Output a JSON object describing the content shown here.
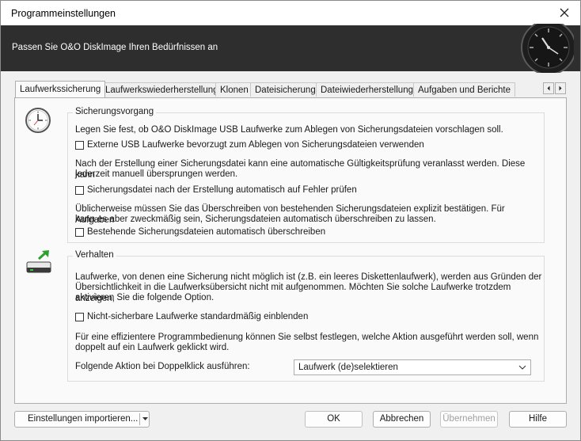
{
  "window": {
    "title": "Programmeinstellungen",
    "banner_text": "Passen Sie O&O DiskImage Ihren Bedürfnissen an"
  },
  "tabs": [
    {
      "label": "Laufwerkssicherung",
      "active": true
    },
    {
      "label": "Laufwerkswiederherstellung",
      "active": false
    },
    {
      "label": "Klonen",
      "active": false
    },
    {
      "label": "Dateisicherung",
      "active": false
    },
    {
      "label": "Dateiwiederherstellung",
      "active": false
    },
    {
      "label": "Aufgaben und Berichte",
      "active": false
    }
  ],
  "group_backup": {
    "title": "Sicherungsvorgang",
    "intro": "Legen Sie fest, ob O&O DiskImage USB Laufwerke zum Ablegen von Sicherungsdateien vorschlagen soll.",
    "chk_usb": "Externe USB Laufwerke bevorzugt zum Ablegen von Sicherungsdateien verwenden",
    "verify_text_1": "Nach der Erstellung einer Sicherungsdatei kann eine automatische Gültigkeitsprüfung veranlasst werden. Diese kann",
    "verify_text_2": "jederzeit manuell übersprungen werden.",
    "chk_verify": "Sicherungsdatei nach der Erstellung automatisch auf Fehler prüfen",
    "overwrite_text_1": "Üblicherweise müssen Sie das Überschreiben von bestehenden Sicherungsdateien explizit bestätigen. Für Aufgaben",
    "overwrite_text_2": "kann es aber zweckmäßig sein, Sicherungsdateien automatisch überschreiben zu lassen.",
    "chk_overwrite": "Bestehende Sicherungsdateien automatisch überschreiben"
  },
  "group_behavior": {
    "title": "Verhalten",
    "drives_text_1": "Laufwerke, von denen eine Sicherung nicht möglich ist (z.B. ein leeres Diskettenlaufwerk), werden aus Gründen der",
    "drives_text_2": "Übersichtlichkeit in die Laufwerksübersicht nicht mit aufgenommen. Möchten Sie solche Laufwerke trotzdem anzeigen,",
    "drives_text_3": "aktivieren Sie die folgende Option.",
    "chk_show": "Nicht-sicherbare Laufwerke standardmäßig einblenden",
    "action_text_1": "Für eine effizientere Programmbedienung können Sie selbst festlegen, welche Aktion ausgeführt werden soll, wenn",
    "action_text_2": "doppelt auf ein Laufwerk geklickt wird.",
    "dbl_label": "Folgende Aktion bei Doppelklick ausführen:",
    "dbl_value": "Laufwerk (de)selektieren"
  },
  "buttons": {
    "import": "Einstellungen importieren...",
    "ok": "OK",
    "cancel": "Abbrechen",
    "apply": "Übernehmen",
    "help": "Hilfe"
  }
}
